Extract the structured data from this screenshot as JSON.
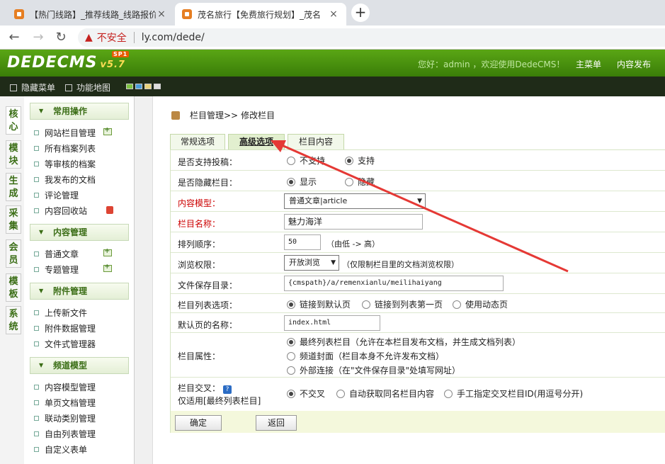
{
  "browser": {
    "tabs": [
      {
        "title": "【热门线路】_推荐线路_线路报价",
        "active": false
      },
      {
        "title": "茂名旅行【免费旅行规划】_茂名",
        "active": true
      }
    ],
    "close_glyph": "×",
    "newtab_glyph": "+",
    "security_label": "不安全",
    "url": "ly.com/dede/"
  },
  "header": {
    "logo_text": "DEDECMS",
    "logo_version": "v5.7",
    "logo_badge": "SP1",
    "welcome": "您好：admin ，欢迎使用DedeCMS！",
    "nav": [
      "主菜单",
      "内容发布"
    ]
  },
  "subbar": {
    "hide_menu": "隐藏菜单",
    "function_map": "功能地图",
    "skin_colors": [
      "#7dc242",
      "#4a9bd8",
      "#e8d27a",
      "#dddddd"
    ]
  },
  "vtabs": [
    "核心",
    "模块",
    "生成",
    "采集",
    "会员",
    "模板",
    "系统"
  ],
  "menu": {
    "sections": [
      {
        "title": "常用操作",
        "items": [
          "网站栏目管理",
          "所有档案列表",
          "等审核的档案",
          "我发布的文档",
          "评论管理",
          "内容回收站"
        ]
      },
      {
        "title": "内容管理",
        "items": [
          "普通文章",
          "专题管理"
        ]
      },
      {
        "title": "附件管理",
        "items": [
          "上传新文件",
          "附件数据管理",
          "文件式管理器"
        ]
      },
      {
        "title": "频道模型",
        "items": [
          "内容模型管理",
          "单页文档管理",
          "联动类别管理",
          "自由列表管理",
          "自定义表单"
        ]
      }
    ]
  },
  "main": {
    "breadcrumb_parent": "栏目管理>>",
    "breadcrumb_current": "修改栏目",
    "tabs": [
      "常规选项",
      "高级选项",
      "栏目内容"
    ],
    "fields": {
      "allow_post": {
        "label": "是否支持投稿：",
        "options": [
          "不支持",
          "支持"
        ]
      },
      "hidden": {
        "label": "是否隐藏栏目：",
        "options": [
          "显示",
          "隐藏"
        ]
      },
      "model": {
        "label": "内容模型：",
        "value": "普通文章|article"
      },
      "name": {
        "label": "栏目名称：",
        "value": "魅力海洋"
      },
      "order": {
        "label": "排列顺序：",
        "value": "50",
        "note": "（由低 -> 高）"
      },
      "access": {
        "label": "浏览权限：",
        "value": "开放浏览",
        "note": "（仅限制栏目里的文档浏览权限）"
      },
      "dir": {
        "label": "文件保存目录：",
        "value": "{cmspath}/a/remenxianlu/meilihaiyang"
      },
      "list_opt": {
        "label": "栏目列表选项：",
        "options": [
          "链接到默认页",
          "链接到列表第一页",
          "使用动态页"
        ]
      },
      "default_page": {
        "label": "默认页的名称：",
        "value": "index.html"
      },
      "attr": {
        "label": "栏目属性：",
        "options": [
          "最终列表栏目（允许在本栏目发布文档，并生成文档列表）",
          "频道封面（栏目本身不允许发布文档）",
          "外部连接（在\"文件保存目录\"处填写网址）"
        ]
      },
      "cross": {
        "label": "栏目交叉：",
        "help": "?",
        "sublabel": "仅适用[最终列表栏目]",
        "options": [
          "不交叉",
          "自动获取同名栏目内容",
          "手工指定交叉栏目ID(用逗号分开)"
        ]
      }
    },
    "confirm": "确定",
    "back": "返回"
  }
}
